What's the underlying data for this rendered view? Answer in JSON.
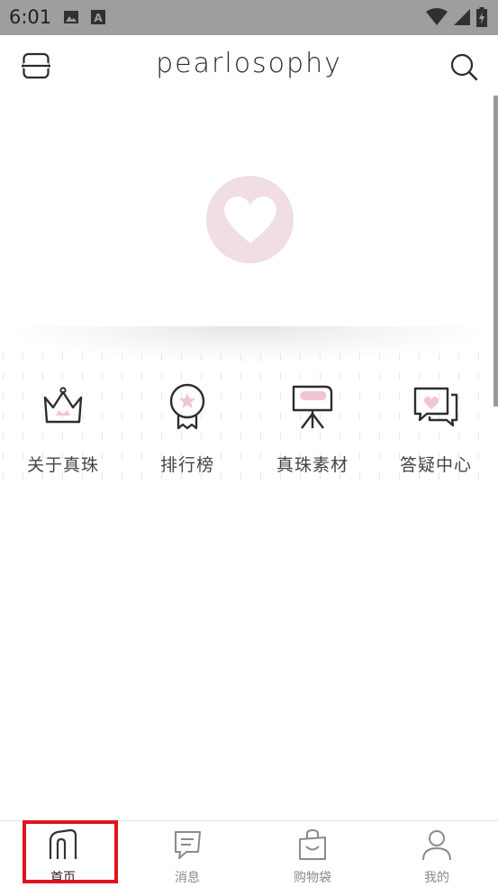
{
  "status_bar": {
    "time": "6:01",
    "left_icons": [
      "image-icon",
      "text-notification-icon"
    ],
    "right_icons": [
      "wifi-icon",
      "signal-icon",
      "battery-icon"
    ]
  },
  "header": {
    "brand": "pearlosophy",
    "left_button_icon": "scan-icon",
    "right_button_icon": "search-icon"
  },
  "banner": {
    "placeholder_icon": "heart-icon",
    "badge_color": "#f1dde6"
  },
  "quick_nav": [
    {
      "label": "关于真珠",
      "icon": "crown-icon"
    },
    {
      "label": "排行榜",
      "icon": "medal-icon"
    },
    {
      "label": "真珠素材",
      "icon": "presentation-board-icon"
    },
    {
      "label": "答疑中心",
      "icon": "chat-heart-icon"
    }
  ],
  "tabbar": [
    {
      "label": "首页",
      "icon": "home-icon",
      "active": true
    },
    {
      "label": "消息",
      "icon": "message-icon",
      "active": false
    },
    {
      "label": "购物袋",
      "icon": "shopping-bag-icon",
      "active": false
    },
    {
      "label": "我的",
      "icon": "profile-icon",
      "active": false
    }
  ],
  "colors": {
    "accent_pink": "#f1c4d8",
    "highlight_red": "#e0141f",
    "status_bar_bg": "#9e9e9e"
  }
}
